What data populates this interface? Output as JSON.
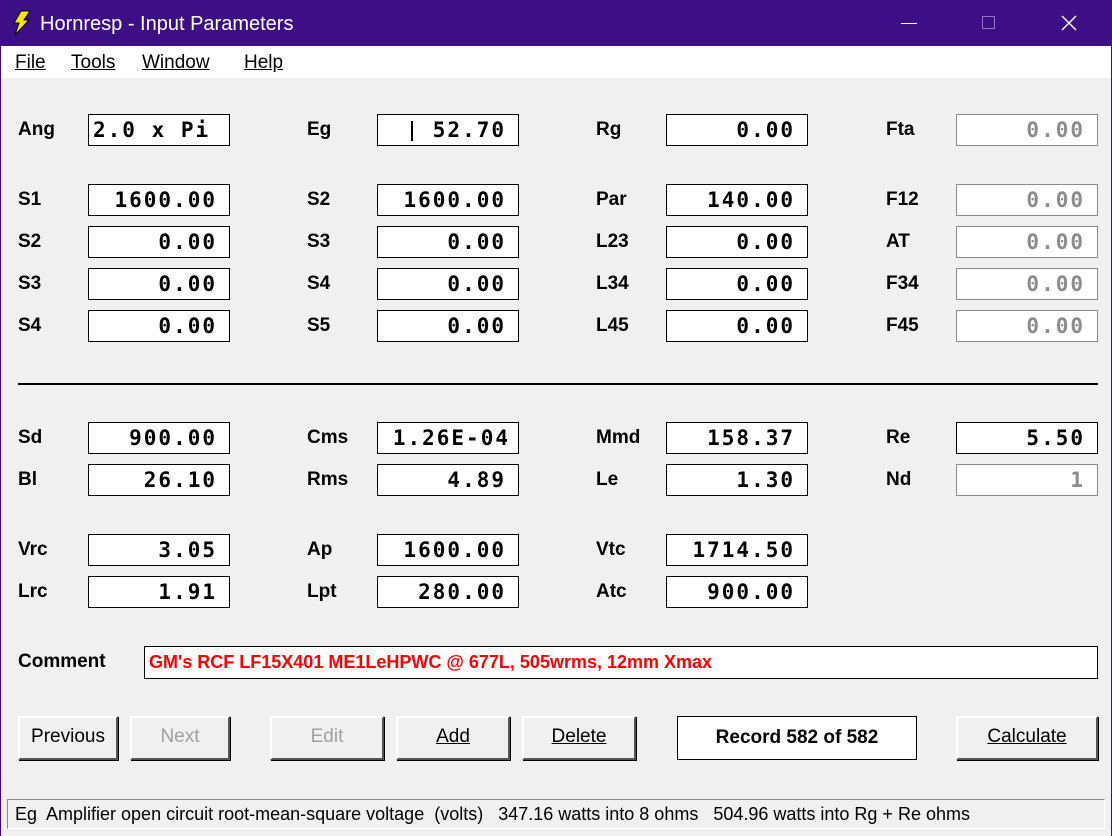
{
  "window": {
    "title": "Hornresp - Input Parameters"
  },
  "menu": [
    "File",
    "Tools",
    "Window",
    "Help"
  ],
  "fields": [
    {
      "label": "Ang",
      "value": "2.0 x Pi",
      "left": true,
      "disabled": false
    },
    {
      "label": "Eg",
      "value": "52.70",
      "disabled": false
    },
    {
      "label": "Rg",
      "value": "0.00",
      "disabled": false
    },
    {
      "label": "Fta",
      "value": "0.00",
      "disabled": true
    },
    {
      "label": "S1",
      "value": "1600.00",
      "disabled": false
    },
    {
      "label": "S2",
      "value": "1600.00",
      "disabled": false
    },
    {
      "label": "Par",
      "value": "140.00",
      "disabled": false
    },
    {
      "label": "F12",
      "value": "0.00",
      "disabled": true
    },
    {
      "label": "S2",
      "value": "0.00",
      "disabled": false
    },
    {
      "label": "S3",
      "value": "0.00",
      "disabled": false
    },
    {
      "label": "L23",
      "value": "0.00",
      "disabled": false
    },
    {
      "label": "AT",
      "value": "0.00",
      "disabled": true
    },
    {
      "label": "S3",
      "value": "0.00",
      "disabled": false
    },
    {
      "label": "S4",
      "value": "0.00",
      "disabled": false
    },
    {
      "label": "L34",
      "value": "0.00",
      "disabled": false
    },
    {
      "label": "F34",
      "value": "0.00",
      "disabled": true
    },
    {
      "label": "S4",
      "value": "0.00",
      "disabled": false
    },
    {
      "label": "S5",
      "value": "0.00",
      "disabled": false
    },
    {
      "label": "L45",
      "value": "0.00",
      "disabled": false
    },
    {
      "label": "F45",
      "value": "0.00",
      "disabled": true
    },
    {
      "label": "Sd",
      "value": "900.00",
      "disabled": false
    },
    {
      "label": "Cms",
      "value": "1.26E-04",
      "disabled": false
    },
    {
      "label": "Mmd",
      "value": "158.37",
      "disabled": false
    },
    {
      "label": "Re",
      "value": "5.50",
      "disabled": false
    },
    {
      "label": "Bl",
      "value": "26.10",
      "disabled": false
    },
    {
      "label": "Rms",
      "value": "4.89",
      "disabled": false
    },
    {
      "label": "Le",
      "value": "1.30",
      "disabled": false
    },
    {
      "label": "Nd",
      "value": "1",
      "disabled": true
    },
    {
      "label": "Vrc",
      "value": "3.05",
      "disabled": false
    },
    {
      "label": "Ap",
      "value": "1600.00",
      "disabled": false
    },
    {
      "label": "Vtc",
      "value": "1714.50",
      "disabled": false
    },
    {
      "label": "Lrc",
      "value": "1.91",
      "disabled": false
    },
    {
      "label": "Lpt",
      "value": "280.00",
      "disabled": false
    },
    {
      "label": "Atc",
      "value": "900.00",
      "disabled": false
    }
  ],
  "comment": {
    "label": "Comment",
    "value": "GM's RCF LF15X401 ME1LeHPWC @ 677L, 505wrms, 12mm Xmax"
  },
  "buttons": {
    "previous": "Previous",
    "next": "Next",
    "edit": "Edit",
    "add": "Add",
    "delete": "Delete",
    "calculate": "Calculate"
  },
  "record": "Record 582 of 582",
  "status": "Eg  Amplifier open circuit root-mean-square voltage  (volts)   347.16 watts into 8 ohms   504.96 watts into Rg + Re ohms",
  "colors": {
    "titlebar": "#3d0f87",
    "comment_text": "#ff0000",
    "disabled_text": "#8c8c8c"
  }
}
